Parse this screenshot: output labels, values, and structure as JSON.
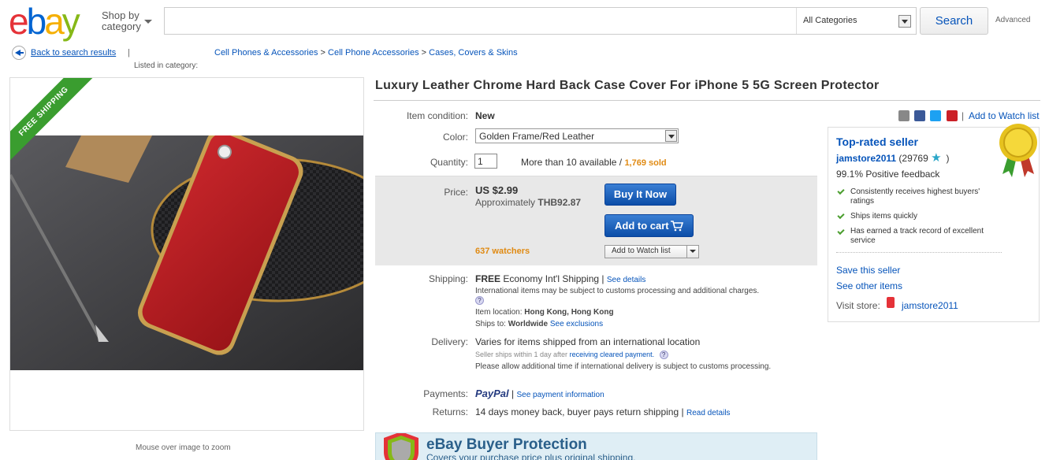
{
  "header": {
    "logo": {
      "e": "e",
      "b": "b",
      "a": "a",
      "y": "y"
    },
    "shop_by_line1": "Shop by",
    "shop_by_line2": "category",
    "search_value": "",
    "category": "All Categories",
    "search_button": "Search",
    "advanced": "Advanced"
  },
  "nav": {
    "back_link": "Back to search results",
    "separator": "|",
    "listed_in": "Listed in category:",
    "breadcrumbs": [
      "Cell Phones & Accessories",
      "Cell Phone Accessories",
      "Cases, Covers & Skins"
    ],
    "crumb_sep": ">"
  },
  "image": {
    "ribbon": "FREE SHIPPING",
    "zoom_hint": "Mouse over image to zoom"
  },
  "item": {
    "title": "Luxury Leather Chrome Hard Back Case Cover For iPhone 5 5G Screen Protector",
    "condition_label": "Item condition:",
    "condition": "New",
    "color_label": "Color:",
    "color_value": "Golden Frame/Red Leather",
    "quantity_label": "Quantity:",
    "quantity_value": "1",
    "availability": "More than 10 available /",
    "sold": "1,769 sold",
    "price_label": "Price:",
    "price": "US $2.99",
    "approx_label": "Approximately",
    "approx_value": "THB92.87",
    "buy_now": "Buy It Now",
    "add_to_cart": "Add to cart",
    "watchers": "637 watchers",
    "add_to_watch": "Add to Watch list"
  },
  "shipping": {
    "label": "Shipping:",
    "free": "FREE",
    "service": "Economy Int'l Shipping",
    "sep": "|",
    "details": "See details",
    "customs_note": "International items may be subject to customs processing and additional charges.",
    "help": "?",
    "location_label": "Item location:",
    "location": "Hong Kong, Hong Kong",
    "ships_to_label": "Ships to:",
    "ships_to": "Worldwide",
    "exclusions": "See exclusions"
  },
  "delivery": {
    "label": "Delivery:",
    "text": "Varies for items shipped from an international location",
    "seller_ships": "Seller ships within 1 day after",
    "receiving": "receiving cleared payment.",
    "help": "?",
    "note": "Please allow additional time if international delivery is subject to customs processing."
  },
  "payments": {
    "label": "Payments:",
    "paypal": "PayPal",
    "sep": "|",
    "link": "See payment information"
  },
  "returns": {
    "label": "Returns:",
    "text": "14 days money back, buyer pays return shipping",
    "sep": "|",
    "link": "Read details"
  },
  "protection": {
    "title": "eBay Buyer Protection",
    "subtitle": "Covers your purchase price plus original shipping."
  },
  "share": {
    "sep": "|",
    "watch_link": "Add to Watch list"
  },
  "seller": {
    "badge": "Top-rated seller",
    "name": "jamstore2011",
    "score": "(29769",
    "score_close": ")",
    "feedback": "99.1% Positive feedback",
    "bullets": [
      "Consistently receives highest buyers' ratings",
      "Ships items quickly",
      "Has earned a track record of excellent service"
    ],
    "save": "Save this seller",
    "other": "See other items",
    "visit_label": "Visit store:",
    "store": "jamstore2011"
  },
  "colors": {
    "link": "#0654ba",
    "price_bg": "#e8e8e8",
    "button": "#0b4da8",
    "orange": "#e08a12"
  }
}
